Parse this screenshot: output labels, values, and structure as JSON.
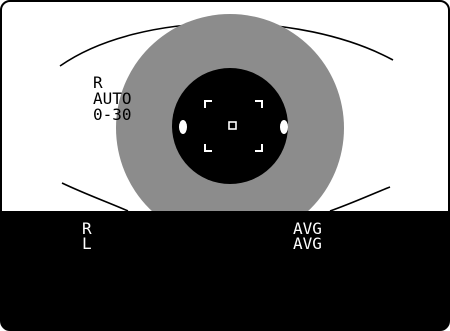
{
  "mode": {
    "eye": "R",
    "program": "AUTO",
    "range": "0-30"
  },
  "readouts": {
    "right_eye": "R",
    "left_eye": "L",
    "right_value": "AVG",
    "left_value": "AVG"
  },
  "colors": {
    "background": "#ffffff",
    "iris": "#8c8c8c",
    "pupil": "#000000",
    "panel": "#000000",
    "marks": "#ffffff"
  },
  "icons": {
    "alignment_reticle": "focus-bracket-icon",
    "center_target": "crosshair-target-icon",
    "reflex_left": "corneal-reflex-dot",
    "reflex_right": "corneal-reflex-dot"
  }
}
